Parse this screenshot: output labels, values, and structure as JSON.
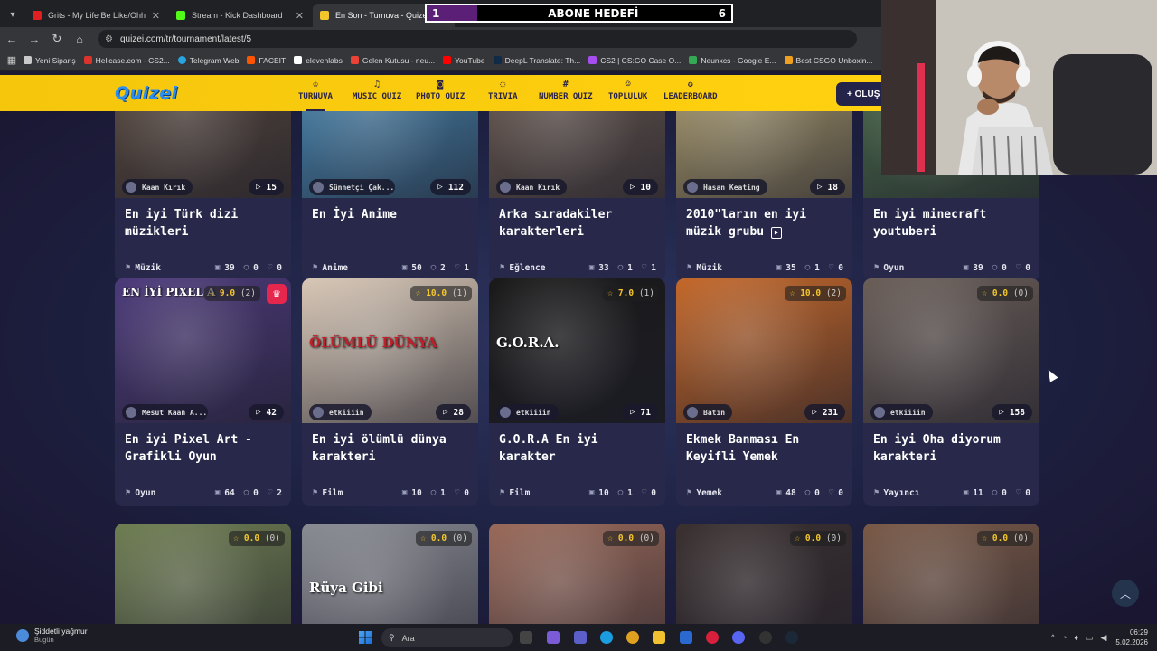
{
  "browser": {
    "tabs": [
      {
        "label": "Grits - My Life Be Like/Ohh Ahh",
        "favicon_color": "#e02020",
        "active": false
      },
      {
        "label": "Stream - Kick Dashboard",
        "favicon_color": "#53fc18",
        "active": false
      },
      {
        "label": "En Son - Turnuva - Quizei",
        "favicon_color": "#f3c62b",
        "active": true
      }
    ],
    "url": "quizei.com/tr/tournament/latest/5",
    "bookmarks": [
      {
        "label": "Yeni Sipariş",
        "color": "#c9c9c9"
      },
      {
        "label": "Hellcase.com - CS2...",
        "color": "#d9332c"
      },
      {
        "label": "Telegram Web",
        "color": "#2aa3e1"
      },
      {
        "label": "FACEIT",
        "color": "#ff5500"
      },
      {
        "label": "elevenlabs",
        "color": "#ffffff"
      },
      {
        "label": "Gelen Kutusu - neu...",
        "color": "#ea4335"
      },
      {
        "label": "YouTube",
        "color": "#ff0000"
      },
      {
        "label": "DeepL Translate: Th...",
        "color": "#0f2b46"
      },
      {
        "label": "CS2 | CS:GO Case O...",
        "color": "#a64df0"
      },
      {
        "label": "Neunxcs - Google E...",
        "color": "#34a853"
      },
      {
        "label": "Best CSGO Unboxin...",
        "color": "#f0a020"
      }
    ]
  },
  "stream_overlay": {
    "goal_current": "1",
    "goal_title": "ABONE HEDEFİ",
    "goal_target": "6",
    "goal_progress": 0.1667
  },
  "site": {
    "logo": "Quizei",
    "nav": [
      {
        "label": "TURNUVA",
        "icon": "trophy-icon"
      },
      {
        "label": "MUSIC QUIZ",
        "icon": "music-icon"
      },
      {
        "label": "PHOTO QUIZ",
        "icon": "camera-icon"
      },
      {
        "label": "TRIVIA",
        "icon": "chat-icon"
      },
      {
        "label": "NUMBER QUIZ",
        "icon": "hash-icon"
      },
      {
        "label": "TOPLULUK",
        "icon": "people-icon"
      },
      {
        "label": "LEADERBOARD",
        "icon": "medal-icon"
      }
    ],
    "create_button": "+ OLUŞ"
  },
  "cards": [
    {
      "author": "Kaan Kırık",
      "plays": "15",
      "title": "En iyi Türk dizi müzikleri",
      "category": "Müzik",
      "questions": "39",
      "comments": "0",
      "likes": "0",
      "rating": "",
      "color": "#5a4a3e"
    },
    {
      "author": "Sünnetçi Çak...",
      "plays": "112",
      "title": "En İyi Anime",
      "category": "Anime",
      "questions": "50",
      "comments": "2",
      "likes": "1",
      "rating": "",
      "color": "#4a8ab5"
    },
    {
      "author": "Kaan Kırık",
      "plays": "10",
      "title": "Arka sıradakiler karakterleri",
      "category": "Eğlence",
      "questions": "33",
      "comments": "1",
      "likes": "1",
      "rating": "",
      "color": "#6a5a50"
    },
    {
      "author": "Hasan Keating",
      "plays": "18",
      "title": "2010\"ların en iyi müzik grubu",
      "category": "Müzik",
      "questions": "35",
      "comments": "1",
      "likes": "0",
      "rating": "",
      "color": "#b0a070"
    },
    {
      "author": "",
      "plays": "",
      "title": "En iyi minecraft youtuberi",
      "category": "Oyun",
      "questions": "39",
      "comments": "0",
      "likes": "0",
      "rating": "",
      "color": "#4a6a4a"
    },
    {
      "author": "Mesut Kaan A...",
      "plays": "42",
      "title": "En iyi Pixel Art - Grafikli Oyun",
      "category": "Oyun",
      "questions": "64",
      "comments": "0",
      "likes": "2",
      "rating": "9.0",
      "rating_count": "(2)",
      "overlay_text": "EN İYİ PIXEL A",
      "color": "#4c3a7a"
    },
    {
      "author": "etkiiiin",
      "plays": "28",
      "title": "En iyi ölümlü dünya karakteri",
      "category": "Film",
      "questions": "10",
      "comments": "1",
      "likes": "0",
      "rating": "10.0",
      "rating_count": "(1)",
      "overlay_text": "ÖLÜMLÜ DÜNYA",
      "color": "#d8c7b5"
    },
    {
      "author": "etkiiiin",
      "plays": "71",
      "title": "G.O.R.A En iyi karakter",
      "category": "Film",
      "questions": "10",
      "comments": "1",
      "likes": "0",
      "rating": "7.0",
      "rating_count": "(1)",
      "overlay_text": "G.O.R.A.",
      "color": "#1a1a1a"
    },
    {
      "author": "Batın",
      "plays": "231",
      "title": "Ekmek Banması En Keyifli Yemek",
      "category": "Yemek",
      "questions": "48",
      "comments": "0",
      "likes": "0",
      "rating": "10.0",
      "rating_count": "(2)",
      "overlay_text": "",
      "color": "#c4682a"
    },
    {
      "author": "etkiiiin",
      "plays": "158",
      "title": "En iyi Oha diyorum karakteri",
      "category": "Yayıncı",
      "questions": "11",
      "comments": "0",
      "likes": "0",
      "rating": "0.0",
      "rating_count": "(0)",
      "overlay_text": "",
      "color": "#6a5e58"
    },
    {
      "rating": "0.0",
      "rating_count": "(0)",
      "overlay_text": "",
      "color": "#6f7e52"
    },
    {
      "rating": "0.0",
      "rating_count": "(0)",
      "overlay_text": "Rüya Gibi",
      "color": "#8a8c94"
    },
    {
      "rating": "0.0",
      "rating_count": "(0)",
      "overlay_text": "",
      "color": "#9a6a5a"
    },
    {
      "rating": "0.0",
      "rating_count": "(0)",
      "overlay_text": "",
      "color": "#3a3030"
    },
    {
      "rating": "0.0",
      "rating_count": "(0)",
      "overlay_text": "",
      "color": "#7a5a48"
    }
  ],
  "taskbar": {
    "weather_title": "Şiddetli yağmur",
    "weather_sub": "Bugün",
    "search_placeholder": "Ara",
    "time": "06:29",
    "date": "5.02.2026"
  }
}
